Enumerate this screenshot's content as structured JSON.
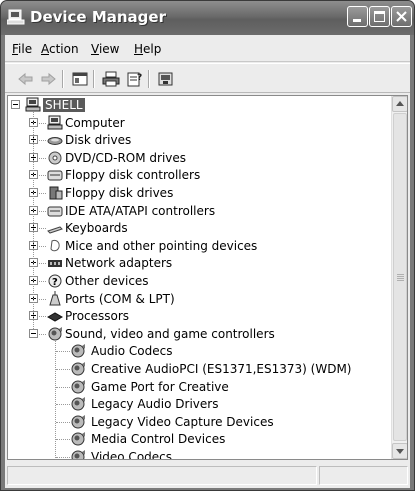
{
  "window": {
    "title": "Device Manager",
    "title_icon": "computer-monitor-icon"
  },
  "menubar": {
    "items": [
      {
        "label": "File",
        "accel": "F",
        "rest": "ile"
      },
      {
        "label": "Action",
        "accel": "A",
        "rest": "ction"
      },
      {
        "label": "View",
        "accel": "V",
        "rest": "iew"
      },
      {
        "label": "Help",
        "accel": "H",
        "rest": "elp"
      }
    ]
  },
  "toolbar": {
    "buttons": [
      "back-arrow-icon",
      "forward-arrow-icon",
      "show-hide-tree-icon",
      "print-icon",
      "properties-icon",
      "help-icon"
    ]
  },
  "tree": {
    "root": {
      "label": "SHELL",
      "icon": "computer-icon",
      "expanded": true,
      "selected": true
    },
    "items": [
      {
        "label": "Computer",
        "icon": "computer-icon",
        "expanded": false
      },
      {
        "label": "Disk drives",
        "icon": "disk-drive-icon",
        "expanded": false
      },
      {
        "label": "DVD/CD-ROM drives",
        "icon": "cdrom-icon",
        "expanded": false
      },
      {
        "label": "Floppy disk controllers",
        "icon": "floppy-controller-icon",
        "expanded": false
      },
      {
        "label": "Floppy disk drives",
        "icon": "floppy-drive-icon",
        "expanded": false
      },
      {
        "label": "IDE ATA/ATAPI controllers",
        "icon": "ide-controller-icon",
        "expanded": false
      },
      {
        "label": "Keyboards",
        "icon": "keyboard-icon",
        "expanded": false
      },
      {
        "label": "Mice and other pointing devices",
        "icon": "mouse-icon",
        "expanded": false
      },
      {
        "label": "Network adapters",
        "icon": "network-adapter-icon",
        "expanded": false
      },
      {
        "label": "Other devices",
        "icon": "unknown-device-icon",
        "expanded": false
      },
      {
        "label": "Ports (COM & LPT)",
        "icon": "port-icon",
        "expanded": false
      },
      {
        "label": "Processors",
        "icon": "processor-icon",
        "expanded": false
      },
      {
        "label": "Sound, video and game controllers",
        "icon": "sound-icon",
        "expanded": true
      }
    ],
    "children": [
      {
        "label": "Audio Codecs",
        "icon": "sound-icon"
      },
      {
        "label": "Creative AudioPCI (ES1371,ES1373) (WDM)",
        "icon": "sound-icon"
      },
      {
        "label": "Game Port for Creative",
        "icon": "sound-icon"
      },
      {
        "label": "Legacy Audio Drivers",
        "icon": "sound-icon"
      },
      {
        "label": "Legacy Video Capture Devices",
        "icon": "sound-icon"
      },
      {
        "label": "Media Control Devices",
        "icon": "sound-icon"
      },
      {
        "label": "Video Codecs",
        "icon": "sound-icon"
      }
    ]
  },
  "colors": {
    "titlebar": "#6a6a6a",
    "selection": "#5a5a5a",
    "face": "#ececec"
  }
}
